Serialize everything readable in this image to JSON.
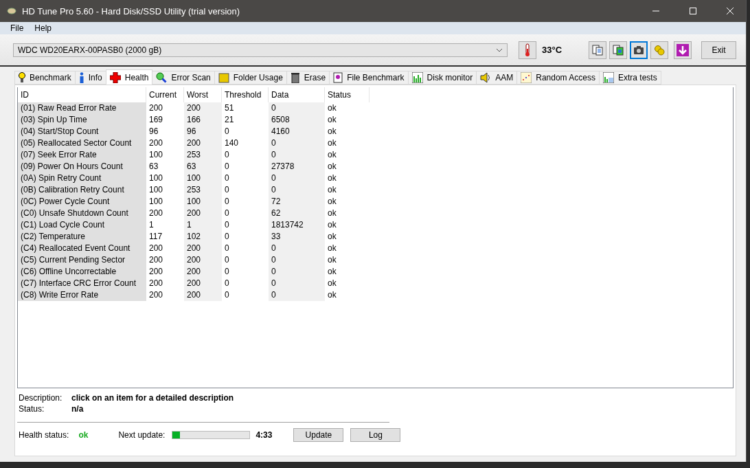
{
  "window": {
    "title": "HD Tune Pro 5.60 - Hard Disk/SSD Utility (trial version)"
  },
  "menu": [
    "File",
    "Help"
  ],
  "toolbar": {
    "drive": "WDC WD20EARX-00PASB0 (2000 gB)",
    "temperature": "33°C",
    "tools": [
      {
        "selected": false
      },
      {
        "selected": false
      },
      {
        "selected": true
      },
      {
        "selected": false
      },
      {
        "selected": false
      }
    ],
    "exit": "Exit"
  },
  "tabs": [
    {
      "label": "Benchmark",
      "selected": false
    },
    {
      "label": "Info",
      "selected": false
    },
    {
      "label": "Health",
      "selected": true
    },
    {
      "label": "Error Scan",
      "selected": false
    },
    {
      "label": "Folder Usage",
      "selected": false
    },
    {
      "label": "Erase",
      "selected": false
    },
    {
      "label": "File Benchmark",
      "selected": false
    },
    {
      "label": "Disk monitor",
      "selected": false
    },
    {
      "label": "AAM",
      "selected": false
    },
    {
      "label": "Random Access",
      "selected": false
    },
    {
      "label": "Extra tests",
      "selected": false
    }
  ],
  "table": {
    "columns": [
      "ID",
      "Current",
      "Worst",
      "Threshold",
      "Data",
      "Status"
    ],
    "rows": [
      [
        "(01) Raw Read Error Rate",
        "200",
        "200",
        "51",
        "0",
        "ok"
      ],
      [
        "(03) Spin Up Time",
        "169",
        "166",
        "21",
        "6508",
        "ok"
      ],
      [
        "(04) Start/Stop Count",
        "96",
        "96",
        "0",
        "4160",
        "ok"
      ],
      [
        "(05) Reallocated Sector Count",
        "200",
        "200",
        "140",
        "0",
        "ok"
      ],
      [
        "(07) Seek Error Rate",
        "100",
        "253",
        "0",
        "0",
        "ok"
      ],
      [
        "(09) Power On Hours Count",
        "63",
        "63",
        "0",
        "27378",
        "ok"
      ],
      [
        "(0A) Spin Retry Count",
        "100",
        "100",
        "0",
        "0",
        "ok"
      ],
      [
        "(0B) Calibration Retry Count",
        "100",
        "253",
        "0",
        "0",
        "ok"
      ],
      [
        "(0C) Power Cycle Count",
        "100",
        "100",
        "0",
        "72",
        "ok"
      ],
      [
        "(C0) Unsafe Shutdown Count",
        "200",
        "200",
        "0",
        "62",
        "ok"
      ],
      [
        "(C1) Load Cycle Count",
        "1",
        "1",
        "0",
        "1813742",
        "ok"
      ],
      [
        "(C2) Temperature",
        "117",
        "102",
        "0",
        "33",
        "ok"
      ],
      [
        "(C4) Reallocated Event Count",
        "200",
        "200",
        "0",
        "0",
        "ok"
      ],
      [
        "(C5) Current Pending Sector",
        "200",
        "200",
        "0",
        "0",
        "ok"
      ],
      [
        "(C6) Offline Uncorrectable",
        "200",
        "200",
        "0",
        "0",
        "ok"
      ],
      [
        "(C7) Interface CRC Error Count",
        "200",
        "200",
        "0",
        "0",
        "ok"
      ],
      [
        "(C8) Write Error Rate",
        "200",
        "200",
        "0",
        "0",
        "ok"
      ]
    ]
  },
  "details": {
    "description_label": "Description:",
    "description": "click on an item for a detailed description",
    "status_label": "Status:",
    "status": "n/a"
  },
  "footer": {
    "health_label": "Health status:",
    "health": "ok",
    "next_label": "Next update:",
    "progress": {
      "level": 0.09
    },
    "countdown": "4:33",
    "buttons": [
      "Update",
      "Log"
    ]
  }
}
